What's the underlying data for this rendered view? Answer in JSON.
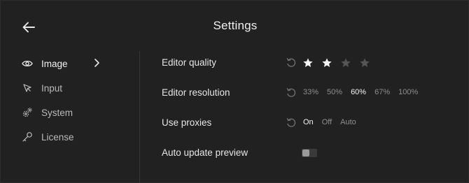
{
  "header": {
    "title": "Settings"
  },
  "sidebar": {
    "items": [
      {
        "label": "Image",
        "icon": "eye-icon",
        "active": true
      },
      {
        "label": "Input",
        "icon": "cursor-icon",
        "active": false
      },
      {
        "label": "System",
        "icon": "gears-icon",
        "active": false
      },
      {
        "label": "License",
        "icon": "key-icon",
        "active": false
      }
    ]
  },
  "settings": {
    "editor_quality": {
      "label": "Editor quality",
      "rating": 2,
      "max": 4
    },
    "editor_resolution": {
      "label": "Editor resolution",
      "options": [
        "33%",
        "50%",
        "60%",
        "67%",
        "100%"
      ],
      "selected": "60%"
    },
    "use_proxies": {
      "label": "Use proxies",
      "options": [
        "On",
        "Off",
        "Auto"
      ],
      "selected": "On"
    },
    "auto_update_preview": {
      "label": "Auto update preview",
      "enabled": false
    }
  },
  "colors": {
    "background": "#212121",
    "text_primary": "#e6e6e6",
    "text_muted": "#8e8e8e",
    "star_filled": "#f4f4f4",
    "star_empty": "#555555"
  }
}
